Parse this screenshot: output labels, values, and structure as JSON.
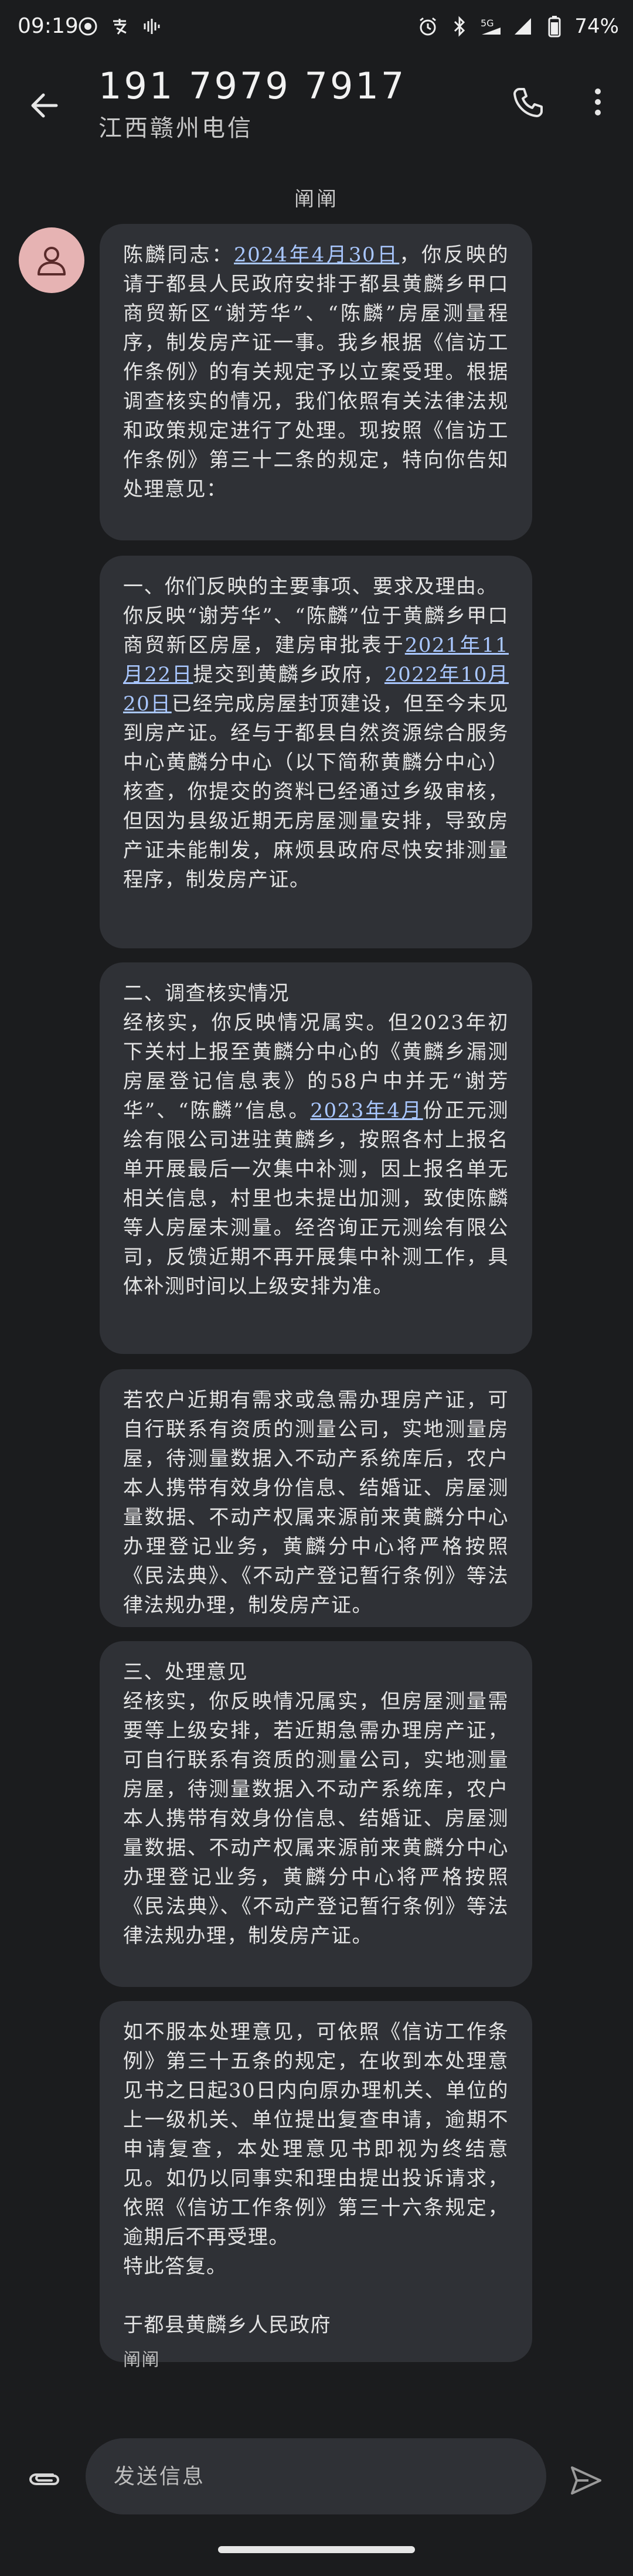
{
  "status_bar": {
    "time": "09:19",
    "battery": "74%",
    "network": "5G"
  },
  "header": {
    "contact_number": "191 7979 7917",
    "contact_subtitle": "江西赣州电信"
  },
  "thread": {
    "sender_label": "阐阐",
    "messages": [
      {
        "segments": [
          "陈麟同志：",
          {
            "link": "2024年4月30日"
          },
          "，你反映的请于都县人民政府安排于都县黄麟乡甲口商贸新区“谢芳华”、“陈麟”房屋测量程序，制发房产证一事。我乡根据《信访工作条例》的有关规定予以立案受理。根据调查核实的情况，我们依照有关法律法规和政策规定进行了处理。现按照《信访工作条例》第三十二条的规定，特向你告知处理意见："
        ]
      },
      {
        "segments": [
          "一、你们反映的主要事项、要求及理由。",
          "你反映“谢芳华”、“陈麟”位于黄麟乡甲口商贸新区房屋，建房审批表于",
          {
            "link": "2021年11月22日"
          },
          "提交到黄麟乡政府，",
          {
            "link": "2022年10月20日"
          },
          "已经完成房屋封顶建设，但至今未见到房产证。经与于都县自然资源综合服务中心黄麟分中心（以下简称黄麟分中心）核查，你提交的资料已经通过乡级审核，但因为县级近期无房屋测量安排，导致房产证未能制发，麻烦县政府尽快安排测量程序，制发房产证。"
        ]
      },
      {
        "segments": [
          "二、调查核实情况",
          "经核实，你反映情况属实。但2023年初下关村上报至黄麟分中心的《黄麟乡漏测房屋登记信息表》的58户中并无“谢芳华”、“陈麟”信息。",
          {
            "link": "2023年4月"
          },
          "份正元测绘有限公司进驻黄麟乡，按照各村上报名单开展最后一次集中补测，因上报名单无相关信息，村里也未提出加测，致使陈麟等人房屋未测量。经咨询正元测绘有限公司，反馈近期不再开展集中补测工作，具体补测时间以上级安排为准。"
        ]
      },
      {
        "segments": [
          "若农户近期有需求或急需办理房产证，可自行联系有资质的测量公司，实地测量房屋，待测量数据入不动产系统库后，农户本人携带有效身份信息、结婚证、房屋测量数据、不动产权属来源前来黄麟分中心办理登记业务，黄麟分中心将严格按照《民法典》、《不动产登记暂行条例》等法律法规办理，制发房产证。"
        ]
      },
      {
        "segments": [
          "三、处理意见",
          "经核实，你反映情况属实，但房屋测量需要等上级安排，若近期急需办理房产证，可自行联系有资质的测量公司，实地测量房屋，待测量数据入不动产系统库，农户本人携带有效身份信息、结婚证、房屋测量数据、不动产权属来源前来黄麟分中心办理登记业务，黄麟分中心将严格按照《民法典》、《不动产登记暂行条例》等法律法规办理，制发房产证。"
        ]
      },
      {
        "segments": [
          "如不服本处理意见，可依照《信访工作条例》第三十五条的规定，在收到本处理意见书之日起30日内向原办理机关、单位的上一级机关、单位提出复查申请，逾期不申请复查，本处理意见书即视为终结意见。如仍以同事实和理由提出投诉请求，依照《信访工作条例》第三十六条规定，逾期后不再受理。",
          "特此答复。",
          "",
          "于都县黄麟乡人民政府"
        ],
        "footer_label": "阐阐"
      }
    ]
  },
  "compose": {
    "placeholder": "发送信息"
  },
  "colors": {
    "background": "#1b1c1e",
    "bubble": "#2f3136",
    "link": "#a9c7ff",
    "avatar": "#e6b3b3"
  }
}
